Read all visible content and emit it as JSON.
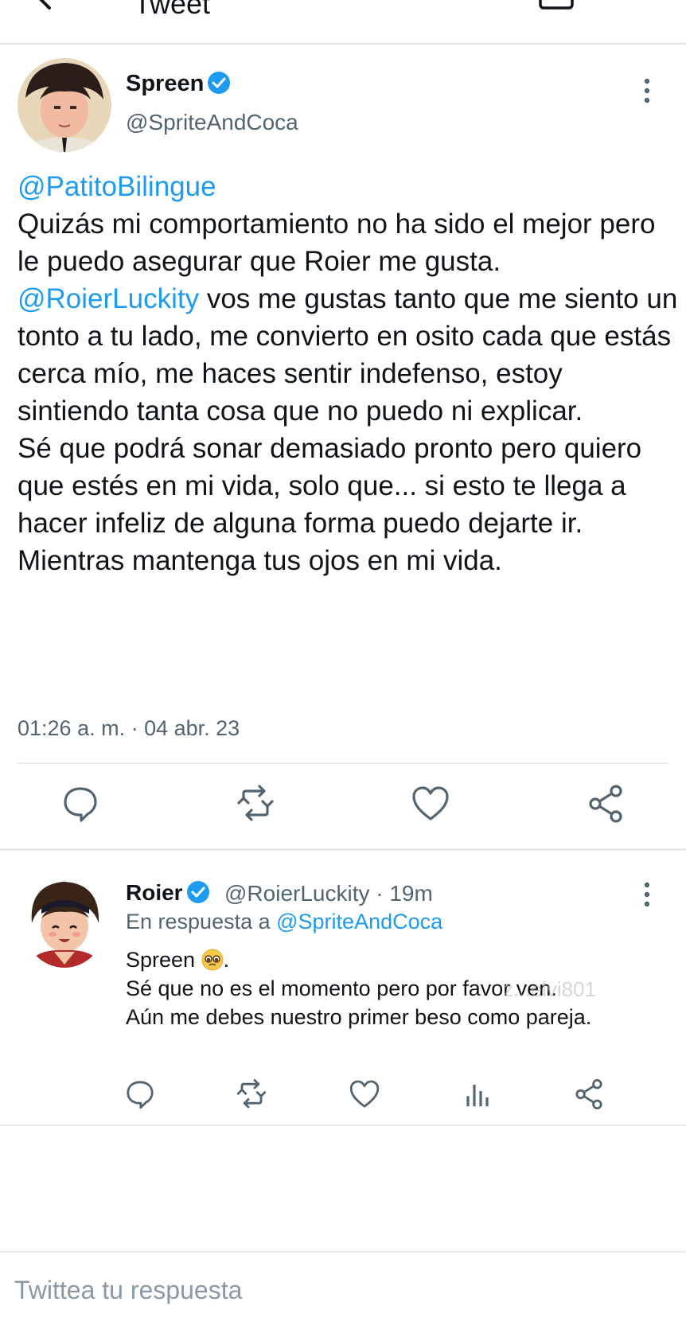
{
  "header": {
    "title": "Tweet",
    "back_icon": "arrow-left-icon",
    "right_icons": [
      "camera-icon",
      "heart-list-icon"
    ]
  },
  "main_tweet": {
    "author": {
      "name": "Spreen",
      "handle": "@SpriteAndCoca",
      "verified": true
    },
    "text": {
      "mention_1": "@PatitoBilingue",
      "line_1": "Quizás mi comportamiento no ha sido el mejor pero le puedo asegurar que Roier me gusta.",
      "mention_2": "@RoierLuckity",
      "line_2": " vos me gustas tanto que me siento un tonto a tu lado, me convierto en osito cada que estás cerca mío, me haces sentir indefenso, estoy sintiendo tanta cosa que no puedo ni explicar.",
      "line_3": "Sé que podrá sonar demasiado pronto pero quiero que estés en mi vida, solo que... si esto te llega a hacer infeliz de alguna forma puedo dejarte ir.",
      "line_4": "Mientras mantenga tus ojos en mi vida."
    },
    "timestamp": "01:26 a. m. · 04 abr. 23",
    "actions": [
      "reply-icon",
      "retweet-icon",
      "like-icon",
      "share-icon"
    ]
  },
  "reply_tweet": {
    "author": {
      "name": "Roier",
      "handle": "@RoierLuckity · 19m",
      "verified": true
    },
    "reply_to_label": "En respuesta a ",
    "reply_to_mention": "@SpriteAndCoca",
    "text": {
      "line_1": "Spreen",
      "line_1_end": ".",
      "line_2": "Sé que no es el momento pero por favor ven.",
      "line_3": "Aún me debes nuestro primer beso como pareja."
    },
    "watermark": "z...elvi801",
    "actions": [
      "reply-icon",
      "retweet-icon",
      "like-icon",
      "views-icon",
      "share-icon"
    ]
  },
  "compose": {
    "placeholder": "Twittea tu respuesta"
  },
  "colors": {
    "accent": "#1d9bf0",
    "text": "#0f1419",
    "secondary": "#536471",
    "divider": "#e9ebec"
  }
}
